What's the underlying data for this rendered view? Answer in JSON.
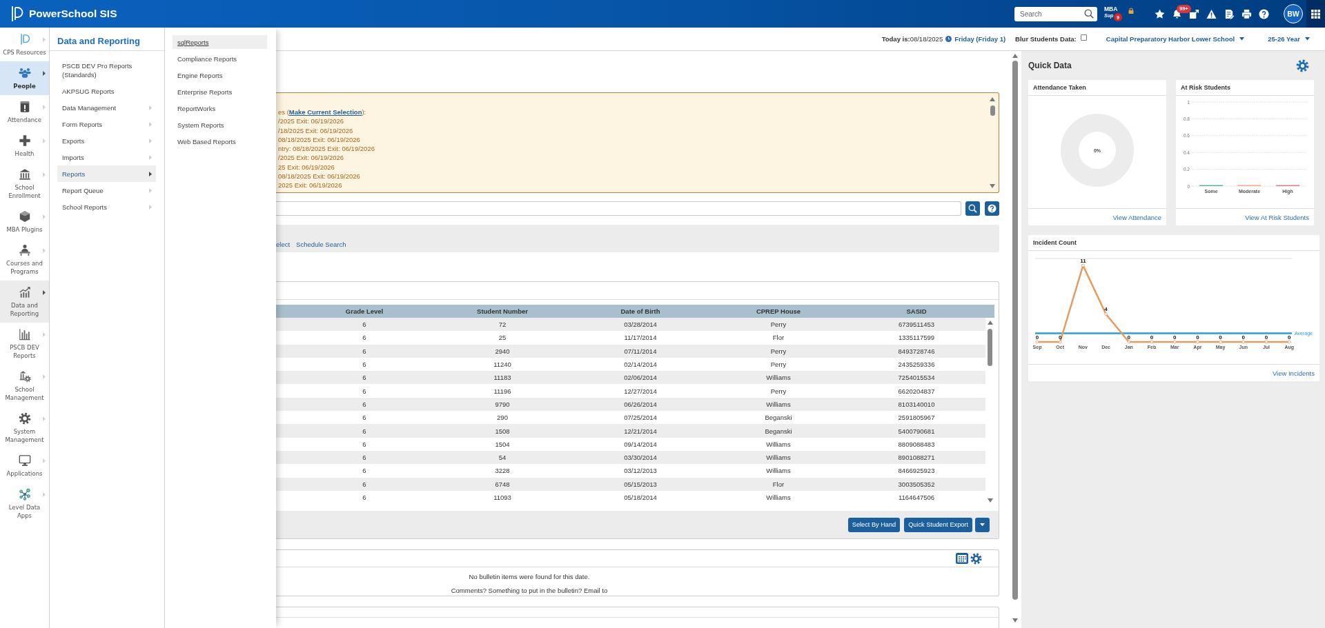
{
  "top_bar": {
    "title": "PowerSchool SIS",
    "search": {
      "placeholder": "Search"
    },
    "mba": {
      "label": "MBA",
      "sublabel": "Sup",
      "badge": "9"
    },
    "notifications": {
      "badge": "99+"
    },
    "avatar": "BW"
  },
  "nav": [
    {
      "label": "CPS Resources",
      "selected": false,
      "expanded": false
    },
    {
      "label": "People",
      "selected": true,
      "expanded": false
    },
    {
      "label": "Attendance",
      "selected": false,
      "expanded": false
    },
    {
      "label": "Health",
      "selected": false,
      "expanded": false
    },
    {
      "label": "School Enrollment",
      "selected": false,
      "expanded": false
    },
    {
      "label": "MBA Plugins",
      "selected": false,
      "expanded": false
    },
    {
      "label": "Courses and Programs",
      "selected": false,
      "expanded": false
    },
    {
      "label": "Data and Reporting",
      "selected": false,
      "expanded": true
    },
    {
      "label": "PSCB DEV Reports",
      "selected": false,
      "expanded": false
    },
    {
      "label": "School Management",
      "selected": false,
      "expanded": false
    },
    {
      "label": "System Management",
      "selected": false,
      "expanded": false
    },
    {
      "label": "Applications",
      "selected": false,
      "expanded": false
    },
    {
      "label": "Level Data Apps",
      "selected": false,
      "expanded": false
    }
  ],
  "menu": {
    "title": "Data and Reporting",
    "items": [
      {
        "label": "PSCB DEV Pro Reports (Standards)",
        "submenu": false,
        "selected": false
      },
      {
        "label": "AKPSUG Reports",
        "submenu": false,
        "selected": false
      },
      {
        "label": "Data Management",
        "submenu": true,
        "selected": false
      },
      {
        "label": "Form Reports",
        "submenu": true,
        "selected": false
      },
      {
        "label": "Exports",
        "submenu": true,
        "selected": false
      },
      {
        "label": "Imports",
        "submenu": true,
        "selected": false
      },
      {
        "label": "Reports",
        "submenu": true,
        "selected": true
      },
      {
        "label": "Report Queue",
        "submenu": true,
        "selected": false
      },
      {
        "label": "School Reports",
        "submenu": true,
        "selected": false
      }
    ]
  },
  "submenu": {
    "items": [
      {
        "label": "sqlReports",
        "selected": true
      },
      {
        "label": "Compliance Reports",
        "selected": false
      },
      {
        "label": "Engine Reports",
        "selected": false
      },
      {
        "label": "Enterprise Reports",
        "selected": false
      },
      {
        "label": "ReportWorks",
        "selected": false
      },
      {
        "label": "System Reports",
        "selected": false
      },
      {
        "label": "Web Based Reports",
        "selected": false
      }
    ]
  },
  "date_bar": {
    "today": "**Today is:**08/18/2025",
    "day": "Friday (Friday 1)",
    "blur": {
      "label": "Blur Students Data:",
      "checked": false
    },
    "school": "Capital Preparatory Harbor Lower School",
    "year": "25-26 Year"
  },
  "selection_box": {
    "heading": {
      "before": "es (",
      "link": "Make Current Selection",
      "after": "):"
    },
    "lines": [
      "/2025 Exit: 06/19/2026",
      "/18/2025 Exit: 06/19/2026",
      "08/18/2025 Exit: 06/19/2026",
      "ntry: 08/18/2025 Exit: 06/19/2026",
      "/2025 Exit: 06/19/2026",
      "25 Exit: 06/19/2026",
      "08/18/2025 Exit: 06/19/2026",
      "2025 Exit: 06/19/2026"
    ]
  },
  "search_options": {
    "links": [
      "elect",
      "Schedule Search"
    ]
  },
  "student_table": {
    "columns": [
      "Grade Level",
      "Student Number",
      "Date of Birth",
      "CPREP House",
      "SASID"
    ],
    "rows": [
      [
        "6",
        "72",
        "03/28/2014",
        "Perry",
        "6739511453"
      ],
      [
        "6",
        "25",
        "11/17/2014",
        "Flor",
        "1335117599"
      ],
      [
        "6",
        "2940",
        "07/11/2014",
        "Perry",
        "8493728746"
      ],
      [
        "6",
        "11240",
        "02/14/2014",
        "Perry",
        "2435259336"
      ],
      [
        "6",
        "11183",
        "02/06/2014",
        "Williams",
        "7254015534"
      ],
      [
        "6",
        "11196",
        "12/27/2014",
        "Perry",
        "6620204837"
      ],
      [
        "6",
        "9790",
        "06/26/2014",
        "Williams",
        "8103140010"
      ],
      [
        "6",
        "290",
        "07/25/2014",
        "Beganski",
        "2591805967"
      ],
      [
        "6",
        "1508",
        "12/21/2014",
        "Beganski",
        "5400790681"
      ],
      [
        "6",
        "1504",
        "09/14/2014",
        "Williams",
        "8809088483"
      ],
      [
        "6",
        "54",
        "03/30/2014",
        "Williams",
        "8901088271"
      ],
      [
        "6",
        "3228",
        "03/12/2013",
        "Williams",
        "8466925923"
      ],
      [
        "6",
        "6748",
        "05/15/2013",
        "Flor",
        "3003505352"
      ],
      [
        "6",
        "11093",
        "05/18/2014",
        "Williams",
        "1164647506"
      ]
    ],
    "buttons": [
      "Select By Hand",
      "Quick Student Export"
    ]
  },
  "bulletin": {
    "message": "No bulletin items were found for this date.",
    "comments": "Comments? Something to put in the bulletin? Email to"
  },
  "quick_data": {
    "title": "Quick Data",
    "attendance": {
      "title": "Attendance Taken",
      "center_label": "0%",
      "link": "View Attendance"
    },
    "at_risk": {
      "title": "At Risk Students",
      "chart_data": {
        "type": "bar",
        "series": [
          {
            "name": "Some",
            "color": "#5db891",
            "values": [
              0
            ]
          },
          {
            "name": "Moderate",
            "color": "#f2a98c",
            "values": [
              0
            ]
          },
          {
            "name": "High",
            "color": "#e67a84",
            "values": [
              0
            ]
          }
        ],
        "ylim": [
          0,
          1
        ],
        "yticks": [
          0,
          0.2,
          0.4,
          0.6,
          0.8,
          1
        ],
        "grid": true
      },
      "link": "View At Risk Students"
    },
    "incidents": {
      "title": "Incident Count",
      "chart_data": {
        "type": "line",
        "categories": [
          "Sep",
          "Oct",
          "Nov",
          "Dec",
          "Jan",
          "Feb",
          "Mar",
          "Apr",
          "May",
          "Jun",
          "Jul",
          "Aug"
        ],
        "series": [
          {
            "color": "#e8995c",
            "marker": "circle",
            "values": [
              0,
              0,
              11,
              4,
              0,
              0,
              0,
              0,
              0,
              0,
              0,
              0
            ]
          }
        ],
        "data_labels": true,
        "ref_lines": [
          {
            "axis": "y",
            "label": "Average",
            "color": "#2a9fd6"
          }
        ]
      },
      "link": "View Incidents"
    }
  }
}
